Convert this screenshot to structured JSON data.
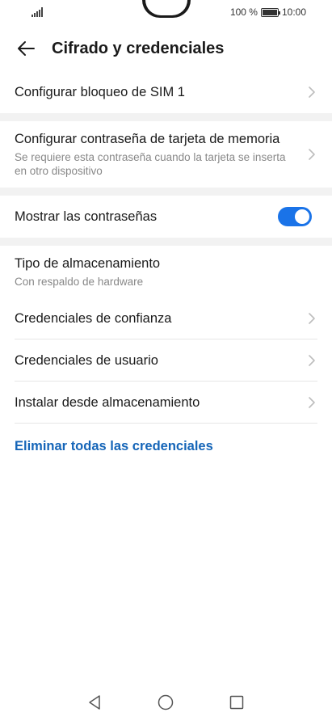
{
  "status": {
    "battery_text": "100 %",
    "time": "10:00",
    "battery_level": 1.0
  },
  "header": {
    "title": "Cifrado y credenciales"
  },
  "items": {
    "sim_lock": {
      "title": "Configurar bloqueo de SIM 1"
    },
    "sd_password": {
      "title": "Configurar contraseña de tarjeta de memoria",
      "subtitle": "Se requiere esta contraseña cuando la tarjeta se inserta en otro dispositivo"
    },
    "show_passwords": {
      "title": "Mostrar las contraseñas",
      "toggle_on": true
    },
    "storage_type": {
      "title": "Tipo de almacenamiento",
      "subtitle": "Con respaldo de hardware"
    },
    "trusted_creds": {
      "title": "Credenciales de confianza"
    },
    "user_creds": {
      "title": "Credenciales de usuario"
    },
    "install_storage": {
      "title": "Instalar desde almacenamiento"
    },
    "clear_creds": {
      "title": "Eliminar todas las credenciales"
    }
  },
  "colors": {
    "accent": "#1a73e8",
    "link": "#1565b8",
    "separator": "#f2f2f2"
  },
  "icons": {
    "back": "arrow-left-icon",
    "chevron": "chevron-right-icon",
    "nav_back": "triangle-back-icon",
    "nav_home": "circle-home-icon",
    "nav_recents": "square-recents-icon"
  }
}
